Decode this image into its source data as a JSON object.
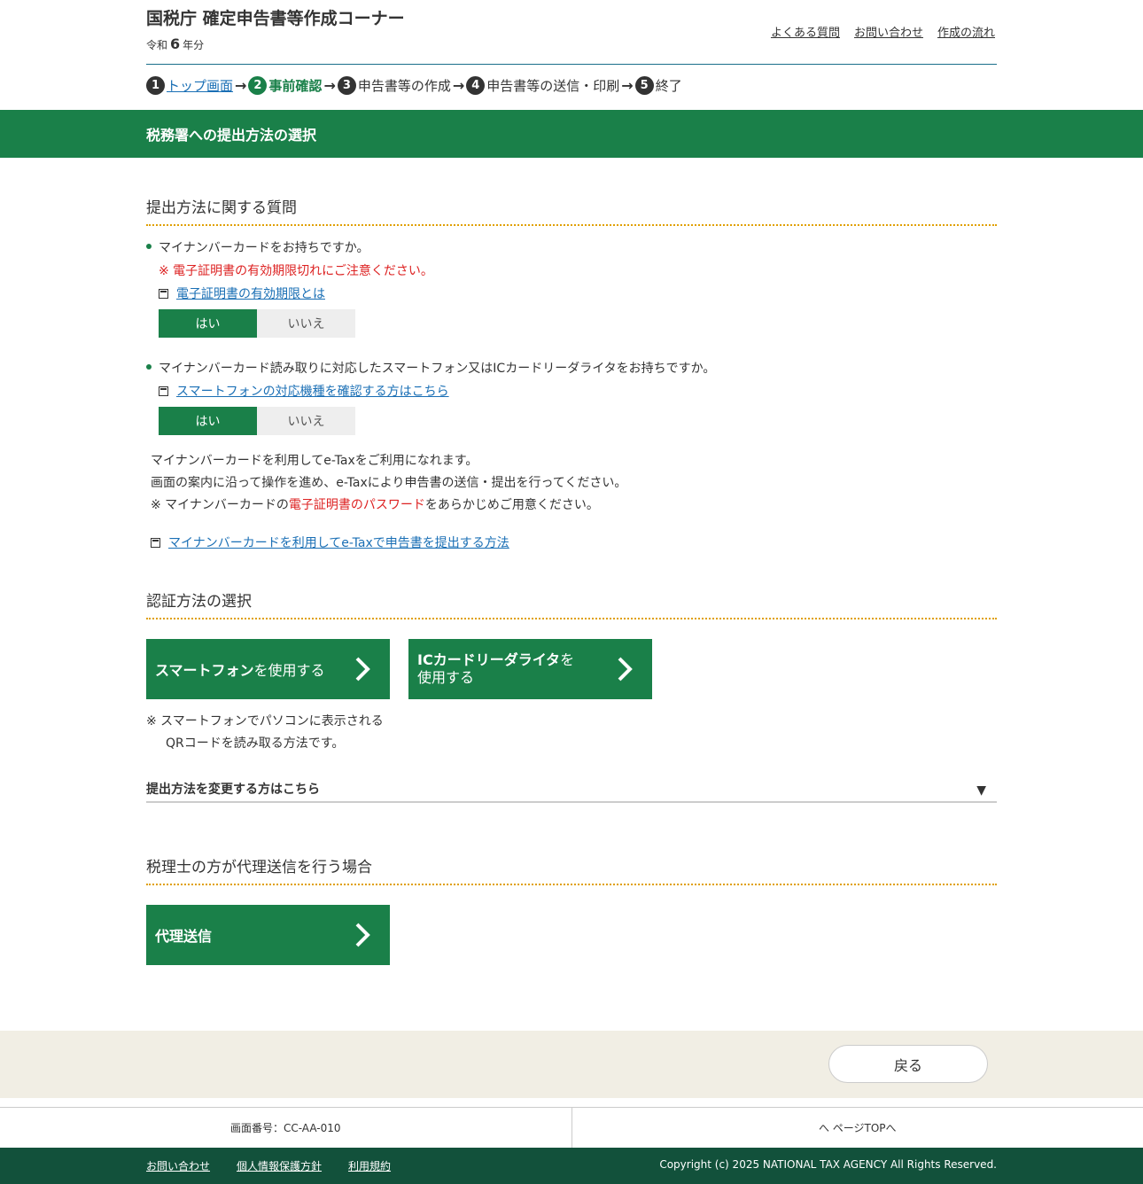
{
  "header": {
    "site_title": "国税庁 確定申告書等作成コーナー",
    "era": "令和",
    "year": "6",
    "year_suffix": "年分",
    "links": [
      "よくある質問",
      "お問い合わせ",
      "作成の流れ"
    ]
  },
  "steps": [
    {
      "num": "1",
      "label": "トップ画面"
    },
    {
      "num": "2",
      "label": "事前確認"
    },
    {
      "num": "3",
      "label": "申告書等の作成"
    },
    {
      "num": "4",
      "label": "申告書等の送信・印刷"
    },
    {
      "num": "5",
      "label": "終了"
    }
  ],
  "page_title": "税務署への提出方法の選択",
  "section1": {
    "title": "提出方法に関する質問",
    "q1": {
      "text": "マイナンバーカードをお持ちですか。",
      "warning": "※ 電子証明書の有効期限切れにご注意ください。",
      "link": "電子証明書の有効期限とは",
      "yes": "はい",
      "no": "いいえ"
    },
    "q2": {
      "text": "マイナンバーカード読み取りに対応したスマートフォン又はICカードリーダライタをお持ちですか。",
      "link": "スマートフォンの対応機種を確認する方はこちら",
      "yes": "はい",
      "no": "いいえ"
    },
    "info_line1": "マイナンバーカードを利用してe-Taxをご利用になれます。",
    "info_line2": "画面の案内に沿って操作を進め、e-Taxにより申告書の送信・提出を行ってください。",
    "info_line3_a": "※ マイナンバーカードの",
    "info_line3_red": "電子証明書のパスワード",
    "info_line3_b": "をあらかじめご用意ください。",
    "info_link": "マイナンバーカードを利用してe-Taxで申告書を提出する方法"
  },
  "section2": {
    "title": "認証方法の選択",
    "btn_smartphone_bold": "スマートフォン",
    "btn_smartphone_rest": "を使用する",
    "btn_ic_bold": "ICカードリーダライタ",
    "btn_ic_rest1": "を",
    "btn_ic_rest2": "使用する",
    "note_line1": "※ スマートフォンでパソコンに表示される",
    "note_line2": "QRコードを読み取る方法です。",
    "accordion": "提出方法を変更する方はこちら"
  },
  "section3": {
    "title": "税理士の方が代理送信を行う場合",
    "btn": "代理送信"
  },
  "footer": {
    "back": "戻る",
    "screen_id": "画面番号：CC-AA-010",
    "page_top": "へ ページTOPへ",
    "links": [
      "お問い合わせ",
      "個人情報保護方針",
      "利用規約"
    ],
    "copyright": "Copyright (c) 2025 NATIONAL TAX AGENCY All Rights Reserved."
  },
  "colors": {
    "primary_green": "#1a8049",
    "dark_green": "#12513b",
    "warning_red": "#dd2222",
    "link_blue": "#1a6fb5"
  }
}
